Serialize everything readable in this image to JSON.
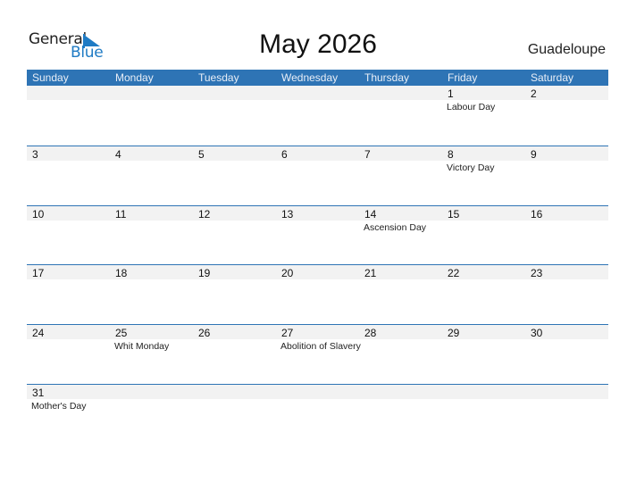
{
  "logo": {
    "word1": "General",
    "word2": "Blue",
    "icon": "triangle-flag-icon",
    "accent": "#1f7bc4"
  },
  "title": "May 2026",
  "region": "Guadeloupe",
  "colors": {
    "header_bg": "#2e74b5",
    "strip_bg": "#f2f2f2"
  },
  "weekdays": [
    "Sunday",
    "Monday",
    "Tuesday",
    "Wednesday",
    "Thursday",
    "Friday",
    "Saturday"
  ],
  "weeks": [
    [
      {
        "day": ""
      },
      {
        "day": ""
      },
      {
        "day": ""
      },
      {
        "day": ""
      },
      {
        "day": ""
      },
      {
        "day": "1",
        "holiday": "Labour Day"
      },
      {
        "day": "2"
      }
    ],
    [
      {
        "day": "3"
      },
      {
        "day": "4"
      },
      {
        "day": "5"
      },
      {
        "day": "6"
      },
      {
        "day": "7"
      },
      {
        "day": "8",
        "holiday": "Victory Day"
      },
      {
        "day": "9"
      }
    ],
    [
      {
        "day": "10"
      },
      {
        "day": "11"
      },
      {
        "day": "12"
      },
      {
        "day": "13"
      },
      {
        "day": "14",
        "holiday": "Ascension Day"
      },
      {
        "day": "15"
      },
      {
        "day": "16"
      }
    ],
    [
      {
        "day": "17"
      },
      {
        "day": "18"
      },
      {
        "day": "19"
      },
      {
        "day": "20"
      },
      {
        "day": "21"
      },
      {
        "day": "22"
      },
      {
        "day": "23"
      }
    ],
    [
      {
        "day": "24"
      },
      {
        "day": "25",
        "holiday": "Whit Monday"
      },
      {
        "day": "26"
      },
      {
        "day": "27",
        "holiday": "Abolition of Slavery"
      },
      {
        "day": "28"
      },
      {
        "day": "29"
      },
      {
        "day": "30"
      }
    ],
    [
      {
        "day": "31",
        "holiday": "Mother's Day"
      },
      {
        "day": ""
      },
      {
        "day": ""
      },
      {
        "day": ""
      },
      {
        "day": ""
      },
      {
        "day": ""
      },
      {
        "day": ""
      }
    ]
  ]
}
